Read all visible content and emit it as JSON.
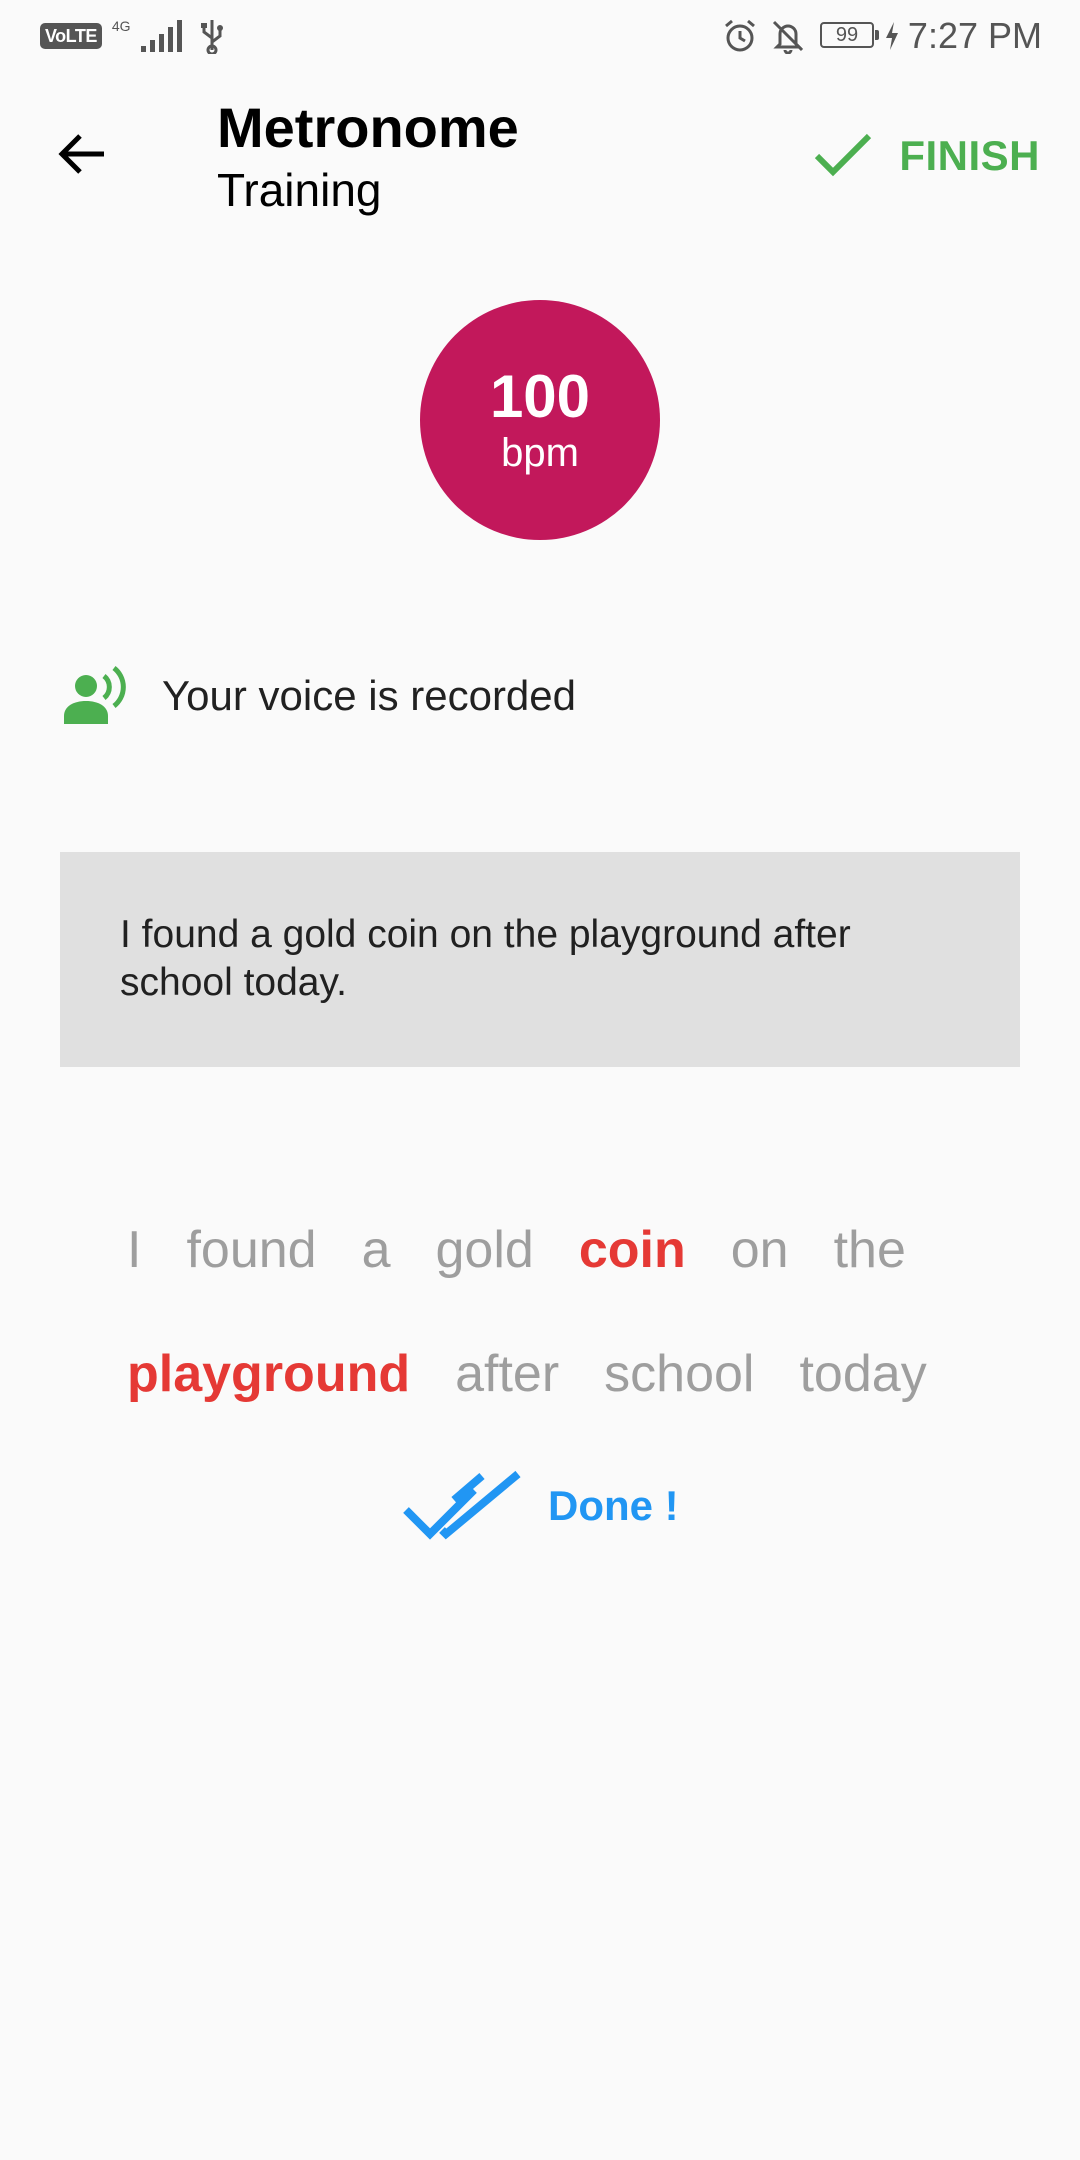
{
  "status_bar": {
    "volte": "VoLTE",
    "network": "4G",
    "battery": "99",
    "time": "7:27 PM",
    "icons": [
      "signal-icon",
      "usb-icon",
      "alarm-icon",
      "bell-off-icon",
      "battery-icon",
      "charging-icon"
    ]
  },
  "app_bar": {
    "title": "Metronome",
    "subtitle": "Training",
    "finish_label": "FINISH",
    "back_icon": "arrow-back-icon",
    "finish_icon": "check-icon",
    "accent_color": "#4caf50"
  },
  "metronome": {
    "value": "100",
    "unit": "bpm",
    "color": "#c2185b"
  },
  "voice": {
    "text": "Your voice is recorded",
    "icon": "voice-recording-icon"
  },
  "sentence": {
    "text": "I found a gold coin on the playground after school today."
  },
  "words": {
    "line1": [
      {
        "text": "I",
        "highlighted": false
      },
      {
        "text": "found",
        "highlighted": false
      },
      {
        "text": "a",
        "highlighted": false
      },
      {
        "text": "gold",
        "highlighted": false
      },
      {
        "text": "coin",
        "highlighted": true
      },
      {
        "text": "on",
        "highlighted": false
      },
      {
        "text": "the",
        "highlighted": false
      }
    ],
    "line2": [
      {
        "text": "playground",
        "highlighted": true
      },
      {
        "text": "after",
        "highlighted": false
      },
      {
        "text": "school",
        "highlighted": false
      },
      {
        "text": "today",
        "highlighted": false
      }
    ],
    "highlight_color": "#e53935"
  },
  "done": {
    "label": "Done !",
    "icon": "double-check-icon",
    "color": "#2196f3"
  }
}
